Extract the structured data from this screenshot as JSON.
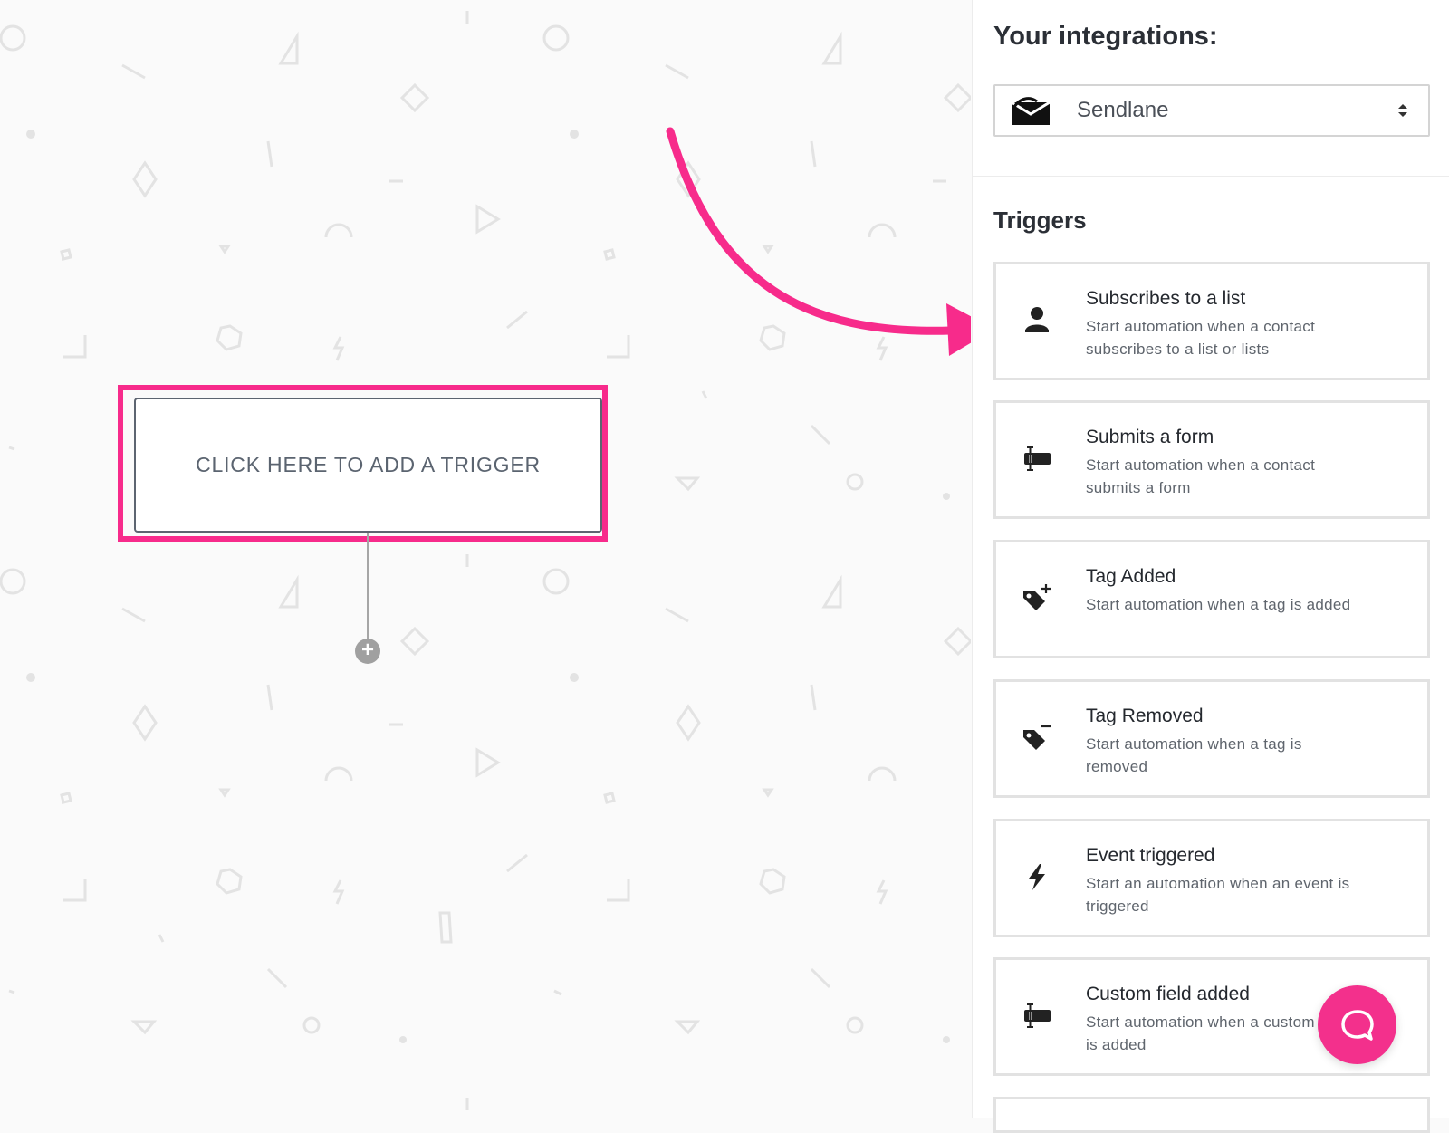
{
  "canvas": {
    "trigger_label": "CLICK HERE TO ADD A TRIGGER",
    "add_step_glyph": "+",
    "highlight_color": "#f72b8b",
    "arrow_color": "#f72b8b"
  },
  "sidebar": {
    "title": "Your integrations:",
    "integration": {
      "selected": "Sendlane",
      "logo_icon": "sendlane-logo-icon",
      "caret_icon": "sort-caret-icon"
    },
    "triggers_heading": "Triggers",
    "triggers": [
      {
        "icon": "user-icon",
        "title": "Subscribes to a list",
        "description": "Start automation when a contact subscribes to a list or lists"
      },
      {
        "icon": "form-field-icon",
        "title": "Submits a form",
        "description": "Start automation when a contact submits a form"
      },
      {
        "icon": "tag-add-icon",
        "title": "Tag Added",
        "description": "Start automation when a tag is added"
      },
      {
        "icon": "tag-remove-icon",
        "title": "Tag Removed",
        "description": "Start automation when a tag is removed"
      },
      {
        "icon": "lightning-icon",
        "title": "Event triggered",
        "description": "Start an automation when an event is triggered"
      },
      {
        "icon": "form-field-icon",
        "title": "Custom field added",
        "description": "Start automation when a custom field is added"
      }
    ]
  },
  "chat": {
    "icon": "chat-bubble-icon",
    "color": "#f3308c"
  }
}
